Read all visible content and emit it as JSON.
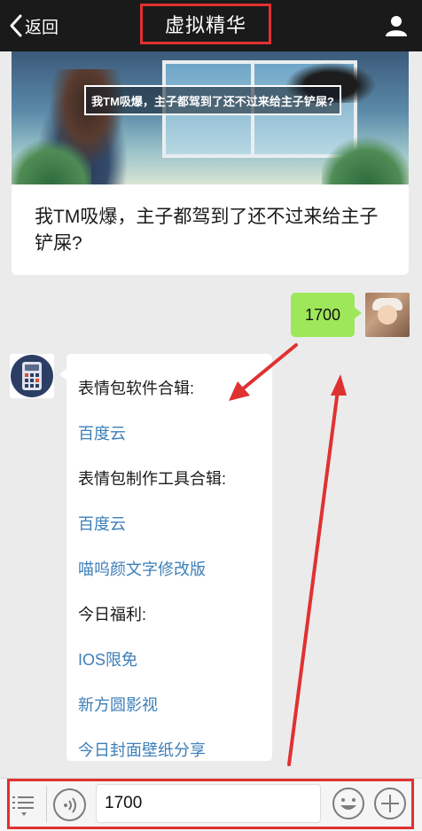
{
  "header": {
    "back_label": "返回",
    "title": "虚拟精华",
    "user_icon": "person-icon"
  },
  "article": {
    "banner_caption": "我TM吸爆，主子都驾到了还不过来给主子铲屎?",
    "title": "我TM吸爆，主子都驾到了还不过来给主子铲屎?"
  },
  "sent_message": {
    "text": "1700"
  },
  "received_message": {
    "avatar_icon": "calculator-icon",
    "lines": [
      {
        "text": "表情包软件合辑:",
        "type": "plain"
      },
      {
        "text": "百度云",
        "type": "link"
      },
      {
        "text": "表情包制作工具合辑:",
        "type": "plain"
      },
      {
        "text": "百度云",
        "type": "link"
      },
      {
        "text": "喵呜颜文字修改版",
        "type": "link"
      },
      {
        "text": "今日福利:",
        "type": "plain"
      },
      {
        "text": "IOS限免",
        "type": "link"
      },
      {
        "text": "新方圆影视",
        "type": "link"
      },
      {
        "text": "今日封面壁纸分享",
        "type": "link"
      }
    ]
  },
  "input_bar": {
    "menu_icon": "list-menu-icon",
    "voice_icon": "voice-icon",
    "input_value": "1700",
    "emoji_icon": "smiley-icon",
    "plus_icon": "plus-icon"
  },
  "colors": {
    "header_bg": "#1a1a1a",
    "sent_bubble": "#9fe75a",
    "link": "#3d7fb8",
    "annotation_red": "#e03131"
  }
}
